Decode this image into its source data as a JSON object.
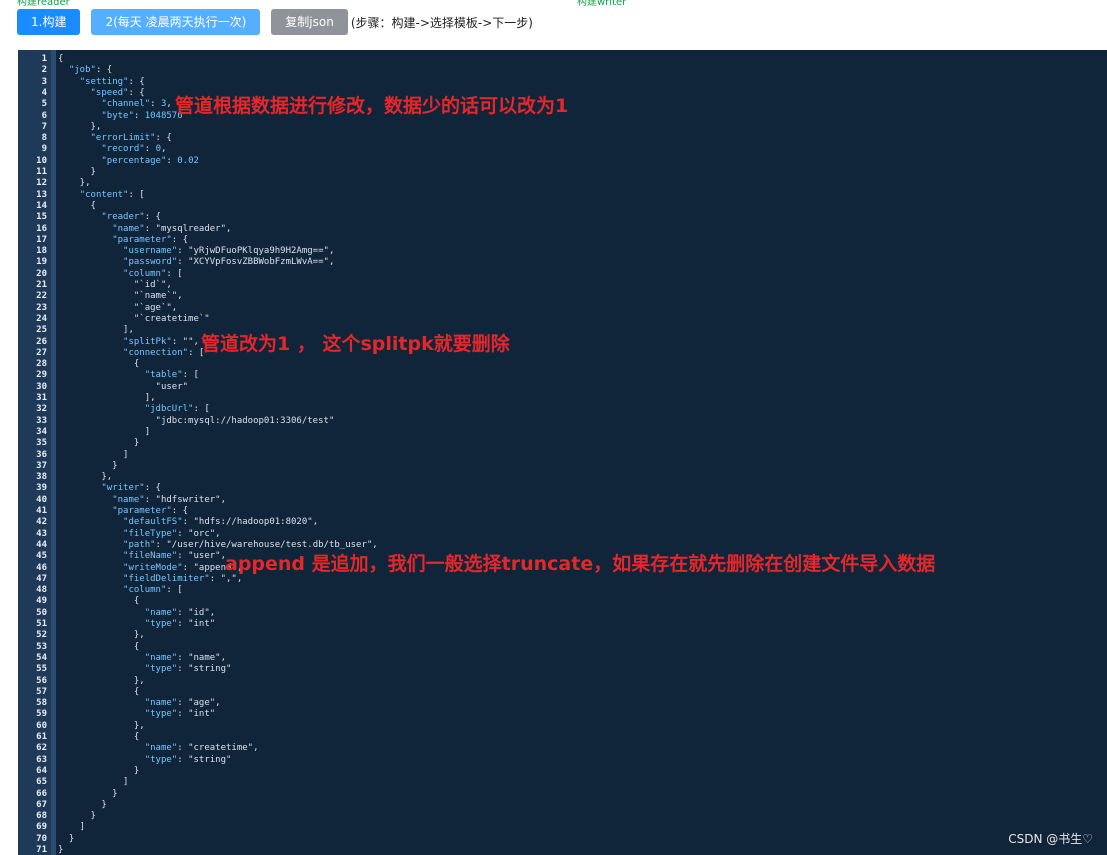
{
  "top_labels": {
    "reader": "构建reader",
    "writer": "构建writer"
  },
  "toolbar": {
    "build_label": "1.构建",
    "schedule_label": "2(每天 凌晨两天执行一次)",
    "copy_json_label": "复制json",
    "steps_text": "(步骤：构建->选择模板->下一步)"
  },
  "editor": {
    "lines": [
      [
        [
          "p",
          "{"
        ]
      ],
      [
        [
          "p",
          "  "
        ],
        [
          "k",
          "\"job\""
        ],
        [
          "p",
          ": {"
        ]
      ],
      [
        [
          "p",
          "    "
        ],
        [
          "k",
          "\"setting\""
        ],
        [
          "p",
          ": {"
        ]
      ],
      [
        [
          "p",
          "      "
        ],
        [
          "k",
          "\"speed\""
        ],
        [
          "p",
          ": {"
        ]
      ],
      [
        [
          "p",
          "        "
        ],
        [
          "k",
          "\"channel\""
        ],
        [
          "p",
          ": "
        ],
        [
          "n",
          "3"
        ],
        [
          "p",
          ","
        ]
      ],
      [
        [
          "p",
          "        "
        ],
        [
          "k",
          "\"byte\""
        ],
        [
          "p",
          ": "
        ],
        [
          "n",
          "1048576"
        ]
      ],
      [
        [
          "p",
          "      },"
        ]
      ],
      [
        [
          "p",
          "      "
        ],
        [
          "k",
          "\"errorLimit\""
        ],
        [
          "p",
          ": {"
        ]
      ],
      [
        [
          "p",
          "        "
        ],
        [
          "k",
          "\"record\""
        ],
        [
          "p",
          ": "
        ],
        [
          "n",
          "0"
        ],
        [
          "p",
          ","
        ]
      ],
      [
        [
          "p",
          "        "
        ],
        [
          "k",
          "\"percentage\""
        ],
        [
          "p",
          ": "
        ],
        [
          "n",
          "0.02"
        ]
      ],
      [
        [
          "p",
          "      }"
        ]
      ],
      [
        [
          "p",
          "    },"
        ]
      ],
      [
        [
          "p",
          "    "
        ],
        [
          "k",
          "\"content\""
        ],
        [
          "p",
          ": ["
        ]
      ],
      [
        [
          "p",
          "      {"
        ]
      ],
      [
        [
          "p",
          "        "
        ],
        [
          "k",
          "\"reader\""
        ],
        [
          "p",
          ": {"
        ]
      ],
      [
        [
          "p",
          "          "
        ],
        [
          "k",
          "\"name\""
        ],
        [
          "p",
          ": "
        ],
        [
          "s",
          "\"mysqlreader\""
        ],
        [
          "p",
          ","
        ]
      ],
      [
        [
          "p",
          "          "
        ],
        [
          "k",
          "\"parameter\""
        ],
        [
          "p",
          ": {"
        ]
      ],
      [
        [
          "p",
          "            "
        ],
        [
          "k",
          "\"username\""
        ],
        [
          "p",
          ": "
        ],
        [
          "s",
          "\"yRjwDFuoPKlqya9h9H2Amg==\""
        ],
        [
          "p",
          ","
        ]
      ],
      [
        [
          "p",
          "            "
        ],
        [
          "k",
          "\"password\""
        ],
        [
          "p",
          ": "
        ],
        [
          "s",
          "\"XCYVpFosvZBBWobFzmLWvA==\""
        ],
        [
          "p",
          ","
        ]
      ],
      [
        [
          "p",
          "            "
        ],
        [
          "k",
          "\"column\""
        ],
        [
          "p",
          ": ["
        ]
      ],
      [
        [
          "p",
          "              "
        ],
        [
          "s",
          "\"`id`\""
        ],
        [
          "p",
          ","
        ]
      ],
      [
        [
          "p",
          "              "
        ],
        [
          "s",
          "\"`name`\""
        ],
        [
          "p",
          ","
        ]
      ],
      [
        [
          "p",
          "              "
        ],
        [
          "s",
          "\"`age`\""
        ],
        [
          "p",
          ","
        ]
      ],
      [
        [
          "p",
          "              "
        ],
        [
          "s",
          "\"`createtime`\""
        ]
      ],
      [
        [
          "p",
          "            ],"
        ]
      ],
      [
        [
          "p",
          "            "
        ],
        [
          "k",
          "\"splitPk\""
        ],
        [
          "p",
          ": "
        ],
        [
          "s",
          "\"\""
        ],
        [
          "p",
          ","
        ]
      ],
      [
        [
          "p",
          "            "
        ],
        [
          "k",
          "\"connection\""
        ],
        [
          "p",
          ": ["
        ]
      ],
      [
        [
          "p",
          "              {"
        ]
      ],
      [
        [
          "p",
          "                "
        ],
        [
          "k",
          "\"table\""
        ],
        [
          "p",
          ": ["
        ]
      ],
      [
        [
          "p",
          "                  "
        ],
        [
          "s",
          "\"user\""
        ]
      ],
      [
        [
          "p",
          "                ],"
        ]
      ],
      [
        [
          "p",
          "                "
        ],
        [
          "k",
          "\"jdbcUrl\""
        ],
        [
          "p",
          ": ["
        ]
      ],
      [
        [
          "p",
          "                  "
        ],
        [
          "s",
          "\"jdbc:mysql://hadoop01:3306/test\""
        ]
      ],
      [
        [
          "p",
          "                ]"
        ]
      ],
      [
        [
          "p",
          "              }"
        ]
      ],
      [
        [
          "p",
          "            ]"
        ]
      ],
      [
        [
          "p",
          "          }"
        ]
      ],
      [
        [
          "p",
          "        },"
        ]
      ],
      [
        [
          "p",
          "        "
        ],
        [
          "k",
          "\"writer\""
        ],
        [
          "p",
          ": {"
        ]
      ],
      [
        [
          "p",
          "          "
        ],
        [
          "k",
          "\"name\""
        ],
        [
          "p",
          ": "
        ],
        [
          "s",
          "\"hdfswriter\""
        ],
        [
          "p",
          ","
        ]
      ],
      [
        [
          "p",
          "          "
        ],
        [
          "k",
          "\"parameter\""
        ],
        [
          "p",
          ": {"
        ]
      ],
      [
        [
          "p",
          "            "
        ],
        [
          "k",
          "\"defaultFS\""
        ],
        [
          "p",
          ": "
        ],
        [
          "s",
          "\"hdfs://hadoop01:8020\""
        ],
        [
          "p",
          ","
        ]
      ],
      [
        [
          "p",
          "            "
        ],
        [
          "k",
          "\"fileType\""
        ],
        [
          "p",
          ": "
        ],
        [
          "s",
          "\"orc\""
        ],
        [
          "p",
          ","
        ]
      ],
      [
        [
          "p",
          "            "
        ],
        [
          "k",
          "\"path\""
        ],
        [
          "p",
          ": "
        ],
        [
          "s",
          "\"/user/hive/warehouse/test.db/tb_user\""
        ],
        [
          "p",
          ","
        ]
      ],
      [
        [
          "p",
          "            "
        ],
        [
          "k",
          "\"fileName\""
        ],
        [
          "p",
          ": "
        ],
        [
          "s",
          "\"user\""
        ],
        [
          "p",
          ","
        ]
      ],
      [
        [
          "p",
          "            "
        ],
        [
          "k",
          "\"writeMode\""
        ],
        [
          "p",
          ": "
        ],
        [
          "s",
          "\"append\""
        ],
        [
          "p",
          ","
        ]
      ],
      [
        [
          "p",
          "            "
        ],
        [
          "k",
          "\"fieldDelimiter\""
        ],
        [
          "p",
          ": "
        ],
        [
          "s",
          "\",\""
        ],
        [
          "p",
          ","
        ]
      ],
      [
        [
          "p",
          "            "
        ],
        [
          "k",
          "\"column\""
        ],
        [
          "p",
          ": ["
        ]
      ],
      [
        [
          "p",
          "              {"
        ]
      ],
      [
        [
          "p",
          "                "
        ],
        [
          "k",
          "\"name\""
        ],
        [
          "p",
          ": "
        ],
        [
          "s",
          "\"id\""
        ],
        [
          "p",
          ","
        ]
      ],
      [
        [
          "p",
          "                "
        ],
        [
          "k",
          "\"type\""
        ],
        [
          "p",
          ": "
        ],
        [
          "s",
          "\"int\""
        ]
      ],
      [
        [
          "p",
          "              },"
        ]
      ],
      [
        [
          "p",
          "              {"
        ]
      ],
      [
        [
          "p",
          "                "
        ],
        [
          "k",
          "\"name\""
        ],
        [
          "p",
          ": "
        ],
        [
          "s",
          "\"name\""
        ],
        [
          "p",
          ","
        ]
      ],
      [
        [
          "p",
          "                "
        ],
        [
          "k",
          "\"type\""
        ],
        [
          "p",
          ": "
        ],
        [
          "s",
          "\"string\""
        ]
      ],
      [
        [
          "p",
          "              },"
        ]
      ],
      [
        [
          "p",
          "              {"
        ]
      ],
      [
        [
          "p",
          "                "
        ],
        [
          "k",
          "\"name\""
        ],
        [
          "p",
          ": "
        ],
        [
          "s",
          "\"age\""
        ],
        [
          "p",
          ","
        ]
      ],
      [
        [
          "p",
          "                "
        ],
        [
          "k",
          "\"type\""
        ],
        [
          "p",
          ": "
        ],
        [
          "s",
          "\"int\""
        ]
      ],
      [
        [
          "p",
          "              },"
        ]
      ],
      [
        [
          "p",
          "              {"
        ]
      ],
      [
        [
          "p",
          "                "
        ],
        [
          "k",
          "\"name\""
        ],
        [
          "p",
          ": "
        ],
        [
          "s",
          "\"createtime\""
        ],
        [
          "p",
          ","
        ]
      ],
      [
        [
          "p",
          "                "
        ],
        [
          "k",
          "\"type\""
        ],
        [
          "p",
          ": "
        ],
        [
          "s",
          "\"string\""
        ]
      ],
      [
        [
          "p",
          "              }"
        ]
      ],
      [
        [
          "p",
          "            ]"
        ]
      ],
      [
        [
          "p",
          "          }"
        ]
      ],
      [
        [
          "p",
          "        }"
        ]
      ],
      [
        [
          "p",
          "      }"
        ]
      ],
      [
        [
          "p",
          "    ]"
        ]
      ],
      [
        [
          "p",
          "  }"
        ]
      ],
      [
        [
          "p",
          "}"
        ]
      ]
    ]
  },
  "annotations": {
    "channel_note": "管道根据数据进行修改，数据少的话可以改为1",
    "splitpk_note": "管道改为1 ， 这个splitpk就要删除",
    "writemode_note": "append 是追加，我们一般选择truncate，如果存在就先删除在创建文件导入数据"
  },
  "watermark": "CSDN @书生♡",
  "colors": {
    "editor_bg": "#10243a",
    "gutter_bg": "#1f3a58",
    "json_key": "#79c7ff",
    "json_text": "#d7e2ee",
    "annotation": "#e3272b",
    "primary_button": "#1a8cff",
    "light_button": "#56aeff",
    "gray_button": "#909399"
  }
}
